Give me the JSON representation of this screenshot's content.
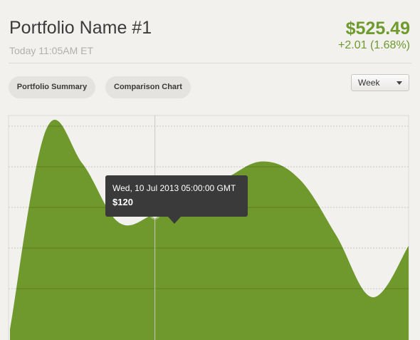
{
  "header": {
    "portfolio_name": "Portfolio Name #1",
    "timestamp": "Today 11:05AM ET",
    "price": "$525.49",
    "change": "+2.01 (1.68%)"
  },
  "tabs": [
    {
      "label": "Portfolio Summary"
    },
    {
      "label": "Comparison Chart"
    }
  ],
  "range_select": {
    "selected": "Week",
    "icon": "chevron-down-icon"
  },
  "tooltip": {
    "date": "Wed, 10 Jul 2013 05:00:00 GMT",
    "value": "$120"
  },
  "colors": {
    "accent": "#6e9a2e",
    "area_fill": "#6f992c",
    "background": "#f2f1ee",
    "tooltip_bg": "#3a3a3a"
  },
  "chart_data": {
    "type": "area",
    "series": [
      {
        "values": [
          0,
          187,
          155,
          100,
          108,
          122,
          142,
          157,
          140,
          88,
          30,
          78
        ]
      }
    ],
    "highlighted_point": {
      "index": 4,
      "label": "$120"
    },
    "grid": true
  }
}
